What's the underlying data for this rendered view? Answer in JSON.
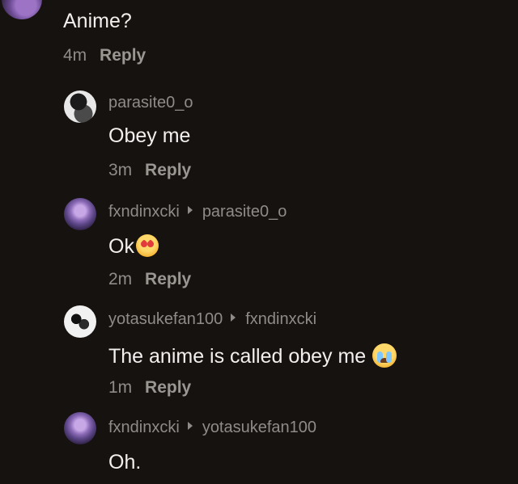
{
  "top_comment": {
    "text": "Anime?",
    "time": "4m",
    "reply_label": "Reply"
  },
  "replies": [
    {
      "username": "parasite0_o",
      "reply_to": "",
      "text": "Obey me",
      "time": "3m",
      "reply_label": "Reply",
      "avatar_icon": "user-avatar-icon"
    },
    {
      "username": "fxndinxcki",
      "reply_to": "parasite0_o",
      "text": "Ok",
      "emoji": "heart-eyes-emoji",
      "time": "2m",
      "reply_label": "Reply",
      "avatar_icon": "user-avatar-icon"
    },
    {
      "username": "yotasukefan100",
      "reply_to": "fxndinxcki",
      "text": "The anime is called obey me",
      "emoji": "crying-face-emoji",
      "time": "1m",
      "reply_label": "Reply",
      "avatar_icon": "user-avatar-icon"
    },
    {
      "username": "fxndinxcki",
      "reply_to": "yotasukefan100",
      "text": "Oh.",
      "avatar_icon": "user-avatar-icon"
    }
  ]
}
